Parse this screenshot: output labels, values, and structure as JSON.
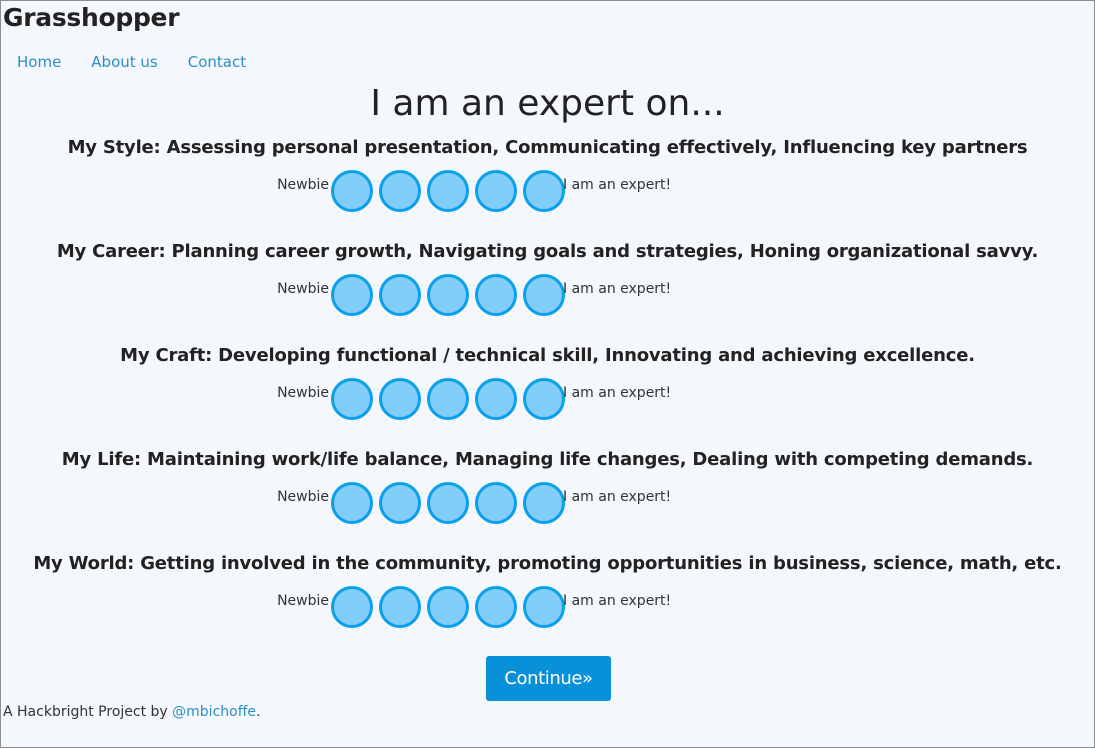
{
  "brand": "Grasshopper",
  "nav": [
    {
      "label": "Home"
    },
    {
      "label": "About us"
    },
    {
      "label": "Contact"
    }
  ],
  "title": "I am an expert on...",
  "scale": {
    "min_label": "Newbie",
    "max_label": "I am an expert!"
  },
  "questions": [
    {
      "label": "My Style: Assessing personal presentation, Communicating effectively, Influencing key partners"
    },
    {
      "label": "My Career: Planning career growth, Navigating goals and strategies, Honing organizational savvy."
    },
    {
      "label": "My Craft: Developing functional / technical skill, Innovating and achieving excellence."
    },
    {
      "label": "My Life: Maintaining work/life balance, Managing life changes, Dealing with competing demands."
    },
    {
      "label": "My World: Getting involved in the community, promoting opportunities in business, science, math, etc."
    }
  ],
  "continue_label": "Continue»",
  "footer": {
    "prefix": "A Hackbright Project by ",
    "link": "@mbichoffe",
    "suffix": "."
  },
  "colors": {
    "dot_fill": "#80cdfa",
    "dot_border": "#0aa0ea",
    "button": "#0891d8",
    "link": "#2a8fc7",
    "background": "#f4f7fb"
  }
}
